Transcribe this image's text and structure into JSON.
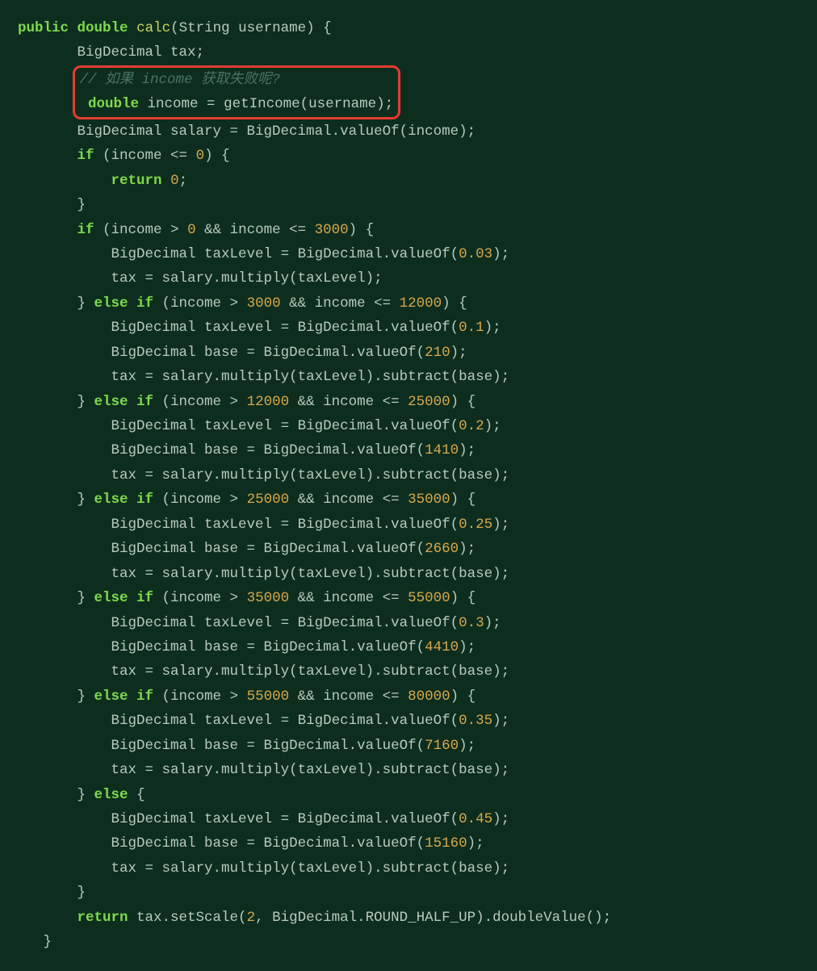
{
  "code": {
    "line1": {
      "kw1": "public",
      "kw2": "double",
      "fn": "calc",
      "sig": "(String username) {"
    },
    "line2": "BigDecimal tax;",
    "comment": "// 如果 income 获取失败呢?",
    "line4": {
      "kw": "double",
      "rest": " income = getIncome(username);"
    },
    "line5": "BigDecimal salary = BigDecimal.valueOf(income);",
    "line6": {
      "kw": "if",
      "cond": " (income <= ",
      "n": "0",
      "rest": ") {"
    },
    "line7": {
      "kw": "return",
      "sp": " ",
      "n": "0",
      "semi": ";"
    },
    "line8": "}",
    "line9": {
      "kw": "if",
      "a": " (income > ",
      "n1": "0",
      "b": " && income <= ",
      "n2": "3000",
      "c": ") {"
    },
    "line10": {
      "a": "BigDecimal taxLevel = BigDecimal.valueOf(",
      "n": "0.03",
      "b": ");"
    },
    "line11": "tax = salary.multiply(taxLevel);",
    "line12": {
      "a": "} ",
      "kw": "else if",
      "b": " (income > ",
      "n1": "3000",
      "c": " && income <= ",
      "n2": "12000",
      "d": ") {"
    },
    "line13": {
      "a": "BigDecimal taxLevel = BigDecimal.valueOf(",
      "n": "0.1",
      "b": ");"
    },
    "line14": {
      "a": "BigDecimal base = BigDecimal.valueOf(",
      "n": "210",
      "b": ");"
    },
    "line15": "tax = salary.multiply(taxLevel).subtract(base);",
    "line16": {
      "a": "} ",
      "kw": "else if",
      "b": " (income > ",
      "n1": "12000",
      "c": " && income <= ",
      "n2": "25000",
      "d": ") {"
    },
    "line17": {
      "a": "BigDecimal taxLevel = BigDecimal.valueOf(",
      "n": "0.2",
      "b": ");"
    },
    "line18": {
      "a": "BigDecimal base = BigDecimal.valueOf(",
      "n": "1410",
      "b": ");"
    },
    "line19": "tax = salary.multiply(taxLevel).subtract(base);",
    "line20": {
      "a": "} ",
      "kw": "else if",
      "b": " (income > ",
      "n1": "25000",
      "c": " && income <= ",
      "n2": "35000",
      "d": ") {"
    },
    "line21": {
      "a": "BigDecimal taxLevel = BigDecimal.valueOf(",
      "n": "0.25",
      "b": ");"
    },
    "line22": {
      "a": "BigDecimal base = BigDecimal.valueOf(",
      "n": "2660",
      "b": ");"
    },
    "line23": "tax = salary.multiply(taxLevel).subtract(base);",
    "line24": {
      "a": "} ",
      "kw": "else if",
      "b": " (income > ",
      "n1": "35000",
      "c": " && income <= ",
      "n2": "55000",
      "d": ") {"
    },
    "line25": {
      "a": "BigDecimal taxLevel = BigDecimal.valueOf(",
      "n": "0.3",
      "b": ");"
    },
    "line26": {
      "a": "BigDecimal base = BigDecimal.valueOf(",
      "n": "4410",
      "b": ");"
    },
    "line27": "tax = salary.multiply(taxLevel).subtract(base);",
    "line28": {
      "a": "} ",
      "kw": "else if",
      "b": " (income > ",
      "n1": "55000",
      "c": " && income <= ",
      "n2": "80000",
      "d": ") {"
    },
    "line29": {
      "a": "BigDecimal taxLevel = BigDecimal.valueOf(",
      "n": "0.35",
      "b": ");"
    },
    "line30": {
      "a": "BigDecimal base = BigDecimal.valueOf(",
      "n": "7160",
      "b": ");"
    },
    "line31": "tax = salary.multiply(taxLevel).subtract(base);",
    "line32": {
      "a": "} ",
      "kw": "else",
      "b": " {"
    },
    "line33": {
      "a": "BigDecimal taxLevel = BigDecimal.valueOf(",
      "n": "0.45",
      "b": ");"
    },
    "line34": {
      "a": "BigDecimal base = BigDecimal.valueOf(",
      "n": "15160",
      "b": ");"
    },
    "line35": "tax = salary.multiply(taxLevel).subtract(base);",
    "line36": "}",
    "line37": {
      "kw": "return",
      "a": " tax.setScale(",
      "n": "2",
      "b": ", BigDecimal.ROUND_HALF_UP).doubleValue();"
    },
    "line38": "}"
  }
}
